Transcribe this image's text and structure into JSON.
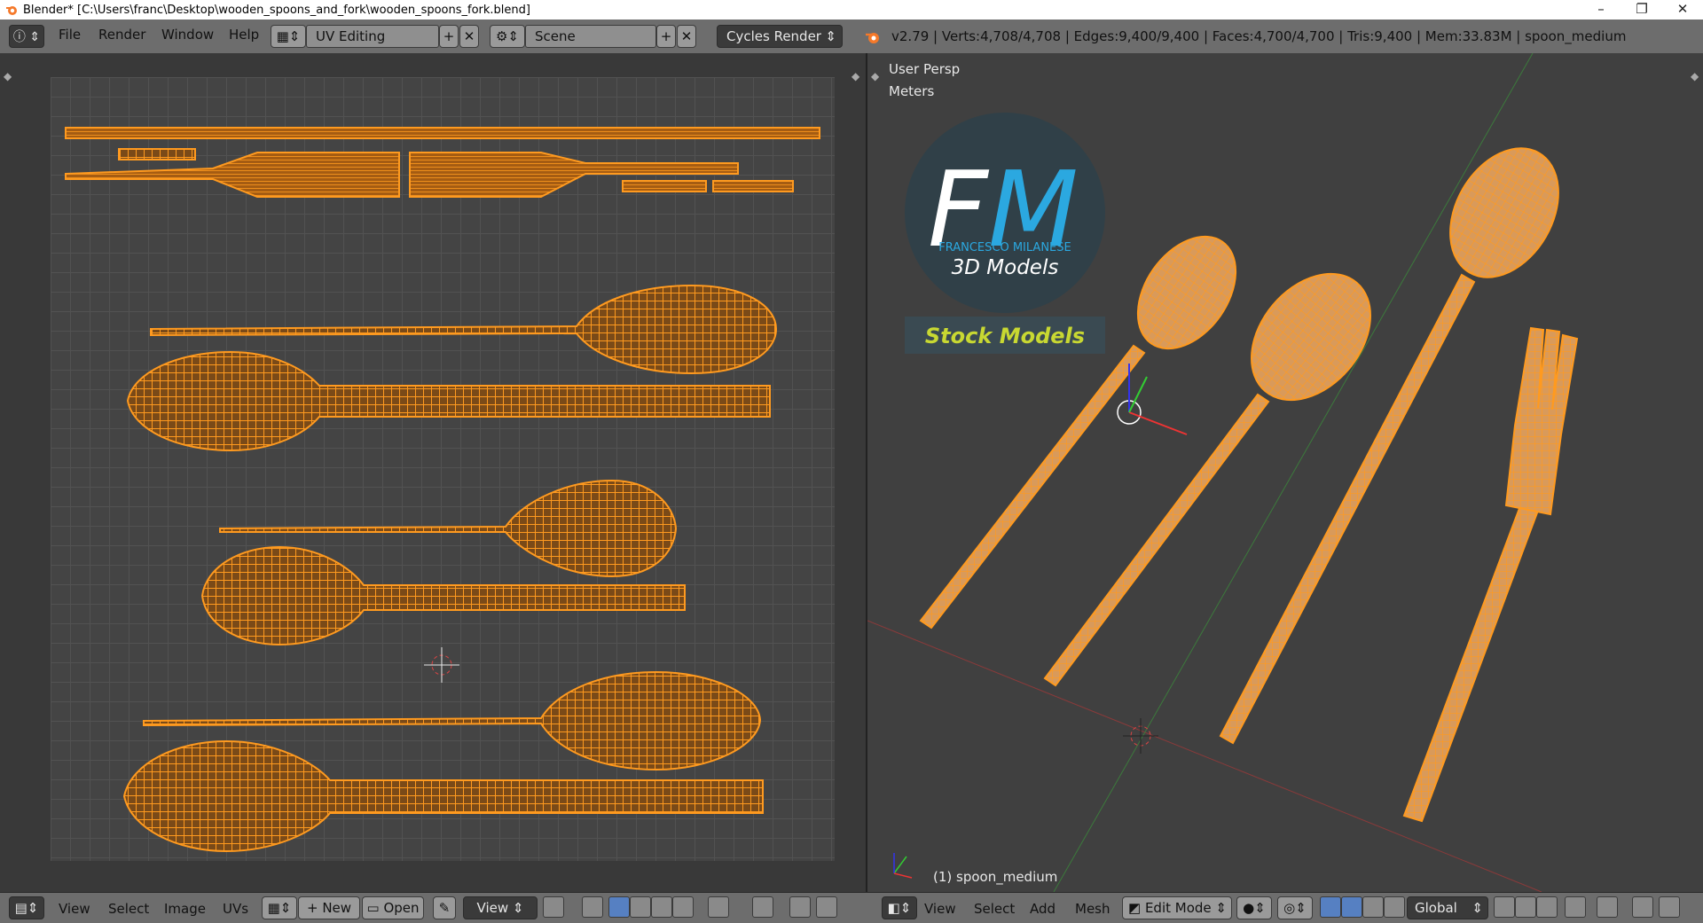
{
  "window": {
    "title": "Blender* [C:\\Users\\franc\\Desktop\\wooden_spoons_and_fork\\wooden_spoons_fork.blend]",
    "controls": [
      "minimize-icon",
      "restore-icon",
      "close-icon"
    ]
  },
  "topbar": {
    "menus": [
      "File",
      "Render",
      "Window",
      "Help"
    ],
    "screen_layout": "UV Editing",
    "scene": "Scene",
    "render_engine": "Cycles Render",
    "stats": "v2.79 | Verts:4,708/4,708 | Edges:9,400/9,400 | Faces:4,700/4,700 | Tris:9,400 | Mem:33.83M | spoon_medium"
  },
  "viewport": {
    "view_name": "User Persp",
    "units": "Meters",
    "object_label": "(1) spoon_medium",
    "logo": {
      "letters_f": "F",
      "letters_m": "M",
      "name": "FRANCESCO MILANESE",
      "tagline": "3D Models",
      "banner": "Stock Models"
    }
  },
  "uv_footer": {
    "menus": [
      "View",
      "Select",
      "Image",
      "UVs"
    ],
    "new_label": "New",
    "open_label": "Open",
    "view_label": "View"
  },
  "view3d_footer": {
    "menus": [
      "View",
      "Select",
      "Add",
      "Mesh"
    ],
    "mode": "Edit Mode",
    "orientation": "Global"
  },
  "colors": {
    "accent": "#ff9a1f",
    "mesh_wire": "#f08a10",
    "logo_blue": "#2ba8e0",
    "banner_text": "#c8d832"
  }
}
